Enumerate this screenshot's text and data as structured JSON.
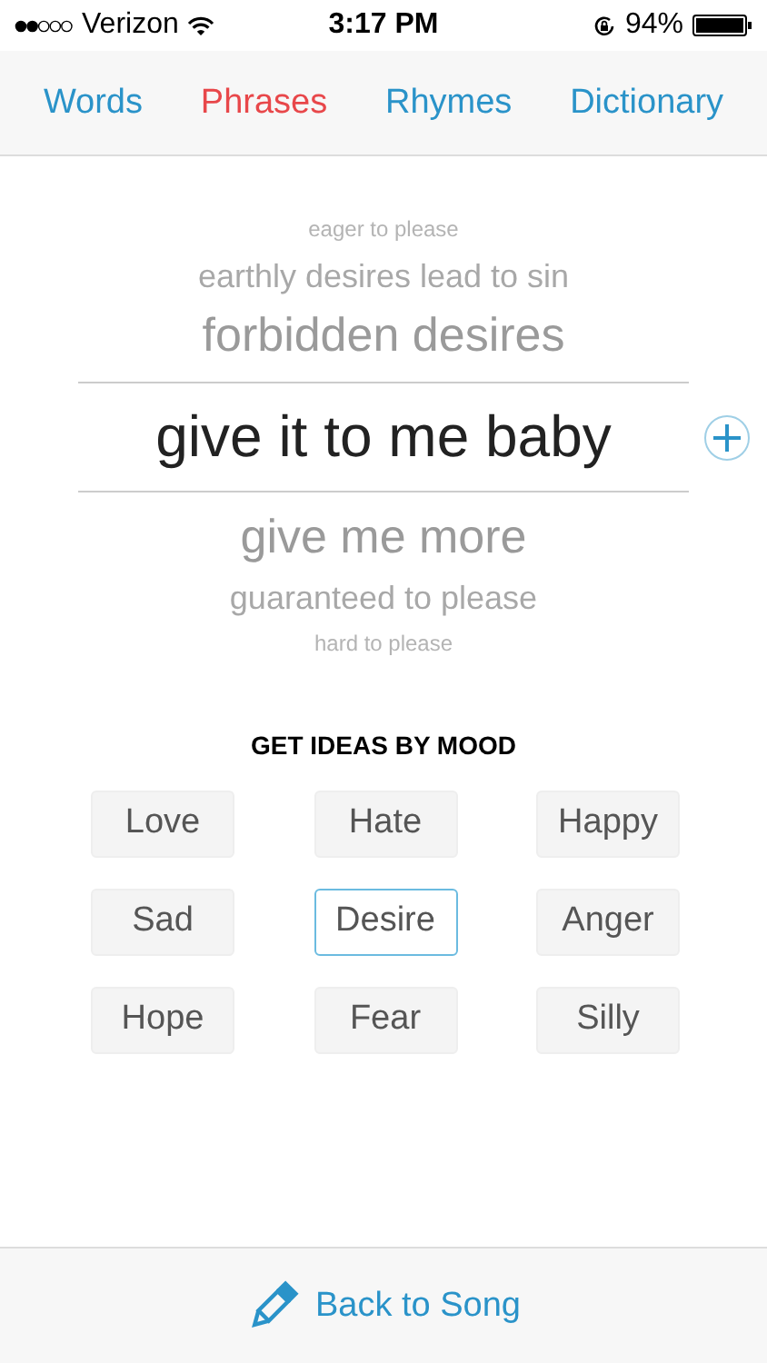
{
  "status_bar": {
    "carrier": "Verizon",
    "time": "3:17 PM",
    "battery": "94%"
  },
  "tabs": [
    {
      "label": "Words",
      "selected": false
    },
    {
      "label": "Phrases",
      "selected": true
    },
    {
      "label": "Rhymes",
      "selected": false
    },
    {
      "label": "Dictionary",
      "selected": false
    }
  ],
  "picker": {
    "items": [
      {
        "text": "eager to please",
        "selected": false
      },
      {
        "text": "earthly desires lead to sin",
        "selected": false
      },
      {
        "text": "forbidden desires",
        "selected": false
      },
      {
        "text": "give it to me baby",
        "selected": true
      },
      {
        "text": "give me more",
        "selected": false
      },
      {
        "text": "guaranteed to please",
        "selected": false
      },
      {
        "text": "hard to please",
        "selected": false
      }
    ]
  },
  "mood": {
    "heading": "GET IDEAS BY MOOD",
    "options": [
      {
        "label": "Love",
        "selected": false
      },
      {
        "label": "Hate",
        "selected": false
      },
      {
        "label": "Happy",
        "selected": false
      },
      {
        "label": "Sad",
        "selected": false
      },
      {
        "label": "Desire",
        "selected": true
      },
      {
        "label": "Anger",
        "selected": false
      },
      {
        "label": "Hope",
        "selected": false
      },
      {
        "label": "Fear",
        "selected": false
      },
      {
        "label": "Silly",
        "selected": false
      }
    ]
  },
  "footer": {
    "button": "Back to Song"
  }
}
